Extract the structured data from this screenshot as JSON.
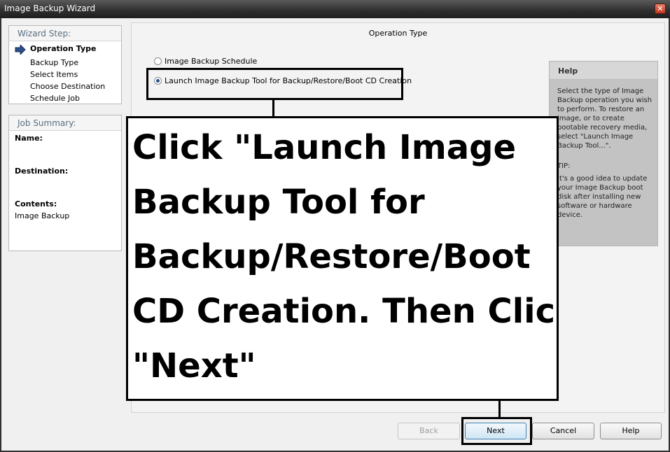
{
  "window": {
    "title": "Image Backup Wizard"
  },
  "wizard_steps": {
    "heading": "Wizard Step:",
    "items": [
      {
        "label": "Operation Type",
        "active": true
      },
      {
        "label": "Backup Type",
        "active": false
      },
      {
        "label": "Select Items",
        "active": false
      },
      {
        "label": "Choose Destination",
        "active": false
      },
      {
        "label": "Schedule Job",
        "active": false
      }
    ]
  },
  "job_summary": {
    "heading": "Job Summary:",
    "name_label": "Name:",
    "name_value": "",
    "destination_label": "Destination:",
    "destination_value": "",
    "contents_label": "Contents:",
    "contents_value": "Image Backup"
  },
  "main": {
    "heading": "Operation Type",
    "options": [
      {
        "label": "Image Backup Schedule",
        "checked": false
      },
      {
        "label": "Launch Image Backup Tool for Backup/Restore/Boot CD Creation",
        "checked": true
      }
    ]
  },
  "help": {
    "title": "Help",
    "text": "Select the type of Image Backup operation you wish to perform.  To restore an image, or to create bootable recovery media, select \"Launch Image Backup Tool...\".",
    "tip_label": "TIP:",
    "tip_text": "It's a good idea to update your Image Backup boot disk after installing new software or hardware device."
  },
  "annotation": {
    "text": "Click \"Launch Image\nBackup Tool for\nBackup/Restore/Boot\nCD Creation. Then Click\n\"Next\""
  },
  "buttons": {
    "back": "Back",
    "next": "Next",
    "cancel": "Cancel",
    "help": "Help"
  },
  "colors": {
    "title_bar": "#2e2e2e",
    "help_panel": "#c3c3c3",
    "accent": "#2a4e86"
  }
}
